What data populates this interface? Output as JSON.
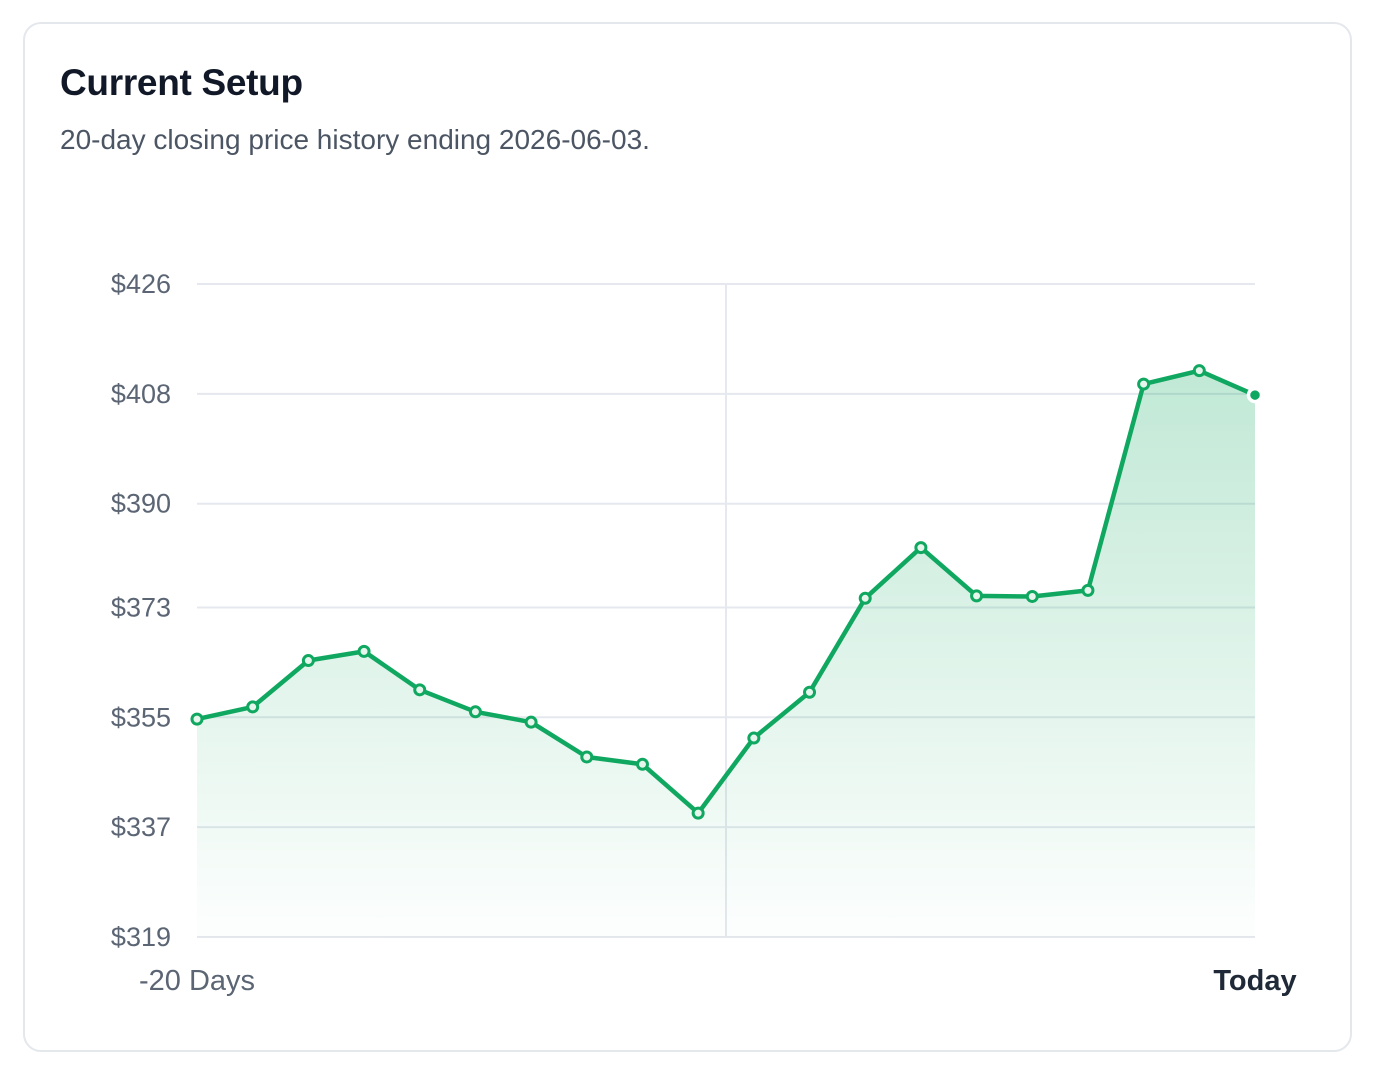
{
  "card": {
    "title": "Current Setup",
    "subtitle": "20-day closing price history ending 2026-06-03."
  },
  "chart_data": {
    "type": "area",
    "title": "Current Setup",
    "subtitle": "20-day closing price history ending 2026-06-03.",
    "x_labels": [
      "-20 Days",
      "Today"
    ],
    "y_tick_labels": [
      "$426",
      "$408",
      "$390",
      "$373",
      "$355",
      "$337",
      "$319"
    ],
    "y_tick_values": [
      426,
      408,
      390,
      373,
      355,
      337,
      319
    ],
    "ylim": [
      319,
      426
    ],
    "grid": true,
    "legend": "none",
    "series": [
      {
        "values": [
          354.7,
          356.7,
          364.3,
          365.8,
          359.5,
          355.9,
          354.2,
          348.5,
          347.3,
          339.3,
          351.6,
          359.1,
          374.5,
          382.8,
          374.9,
          374.8,
          375.8,
          409.6,
          411.8,
          407.8
        ]
      }
    ],
    "colors": {
      "line": "#10a860",
      "fill": "#10a860",
      "grid": "#e5e8ee",
      "tick_text": "#5b6574",
      "end_label": "#1f2937"
    }
  }
}
